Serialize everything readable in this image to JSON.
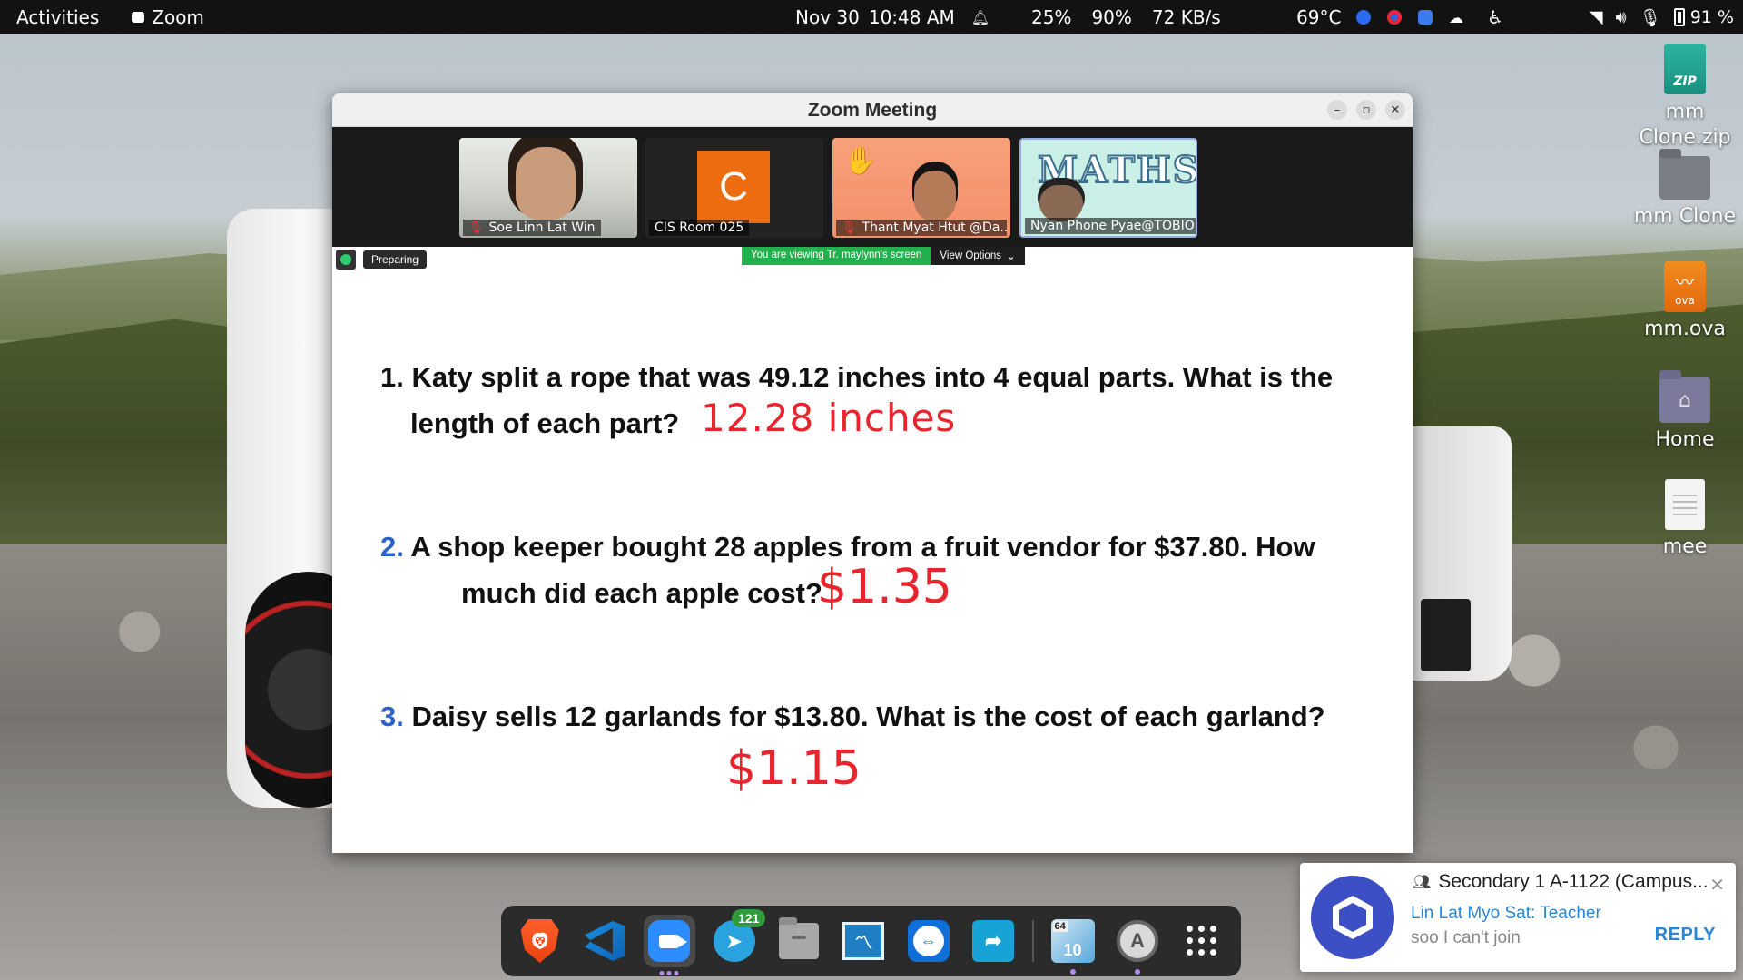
{
  "topbar": {
    "activities": "Activities",
    "app_name": "Zoom",
    "date": "Nov 30",
    "time": "10:48 AM",
    "cpu": "25%",
    "mem": "90%",
    "net": "72 KB/s",
    "temperature": "69°C",
    "battery": "91 %"
  },
  "desktop_icons": [
    {
      "label": "mm Clone.zip",
      "icon": "zip-archive-icon",
      "badge": "ZIP"
    },
    {
      "label": "mm Clone",
      "icon": "folder-icon"
    },
    {
      "label": "mm.ova",
      "icon": "ova-file-icon",
      "badge": "ova"
    },
    {
      "label": "Home",
      "icon": "home-folder-icon"
    },
    {
      "label": "mee",
      "icon": "text-document-icon"
    }
  ],
  "zoom": {
    "title": "Zoom Meeting",
    "participants": [
      {
        "name": "Soe Linn Lat Win",
        "muted": true
      },
      {
        "name": "CIS Room 025",
        "muted": false,
        "avatar_letter": "C"
      },
      {
        "name": "Thant Myat Htut @Da...",
        "muted": true
      },
      {
        "name": "Nyan Phone Pyae@TOBIO",
        "muted": false
      }
    ],
    "maths_text": "MATHS",
    "preparing": "Preparing",
    "viewing_banner": "You are viewing Tr. maylynn's screen",
    "view_options": "View Options",
    "questions": [
      {
        "number": "1.",
        "line1": "Katy split a rope that was 49.12 inches into 4 equal parts. What is the",
        "line2": "length of each part?",
        "answer": "12.28 inches"
      },
      {
        "number": "2.",
        "line1": "A shop keeper bought 28 apples from a fruit vendor for $37.80. How",
        "line2": "much did each apple cost?",
        "answer": "$1.35"
      },
      {
        "number": "3.",
        "line1": "Daisy sells 12 garlands for $13.80. What is the cost of each garland?",
        "line2": "",
        "answer": "$1.15"
      }
    ]
  },
  "dock": {
    "telegram_badge": "121",
    "win10_label": "10",
    "win10_arch": "64"
  },
  "notification": {
    "title": "Secondary 1 A-1122 (Campus...",
    "sender": "Lin Lat Myo Sat: Teacher",
    "message": "soo I can't join",
    "reply": "REPLY"
  },
  "colors": {
    "zoom_blue": "#2d8cff",
    "answer_red": "#e8242c",
    "question_blue": "#2a62c9",
    "banner_green": "#23b14d"
  }
}
